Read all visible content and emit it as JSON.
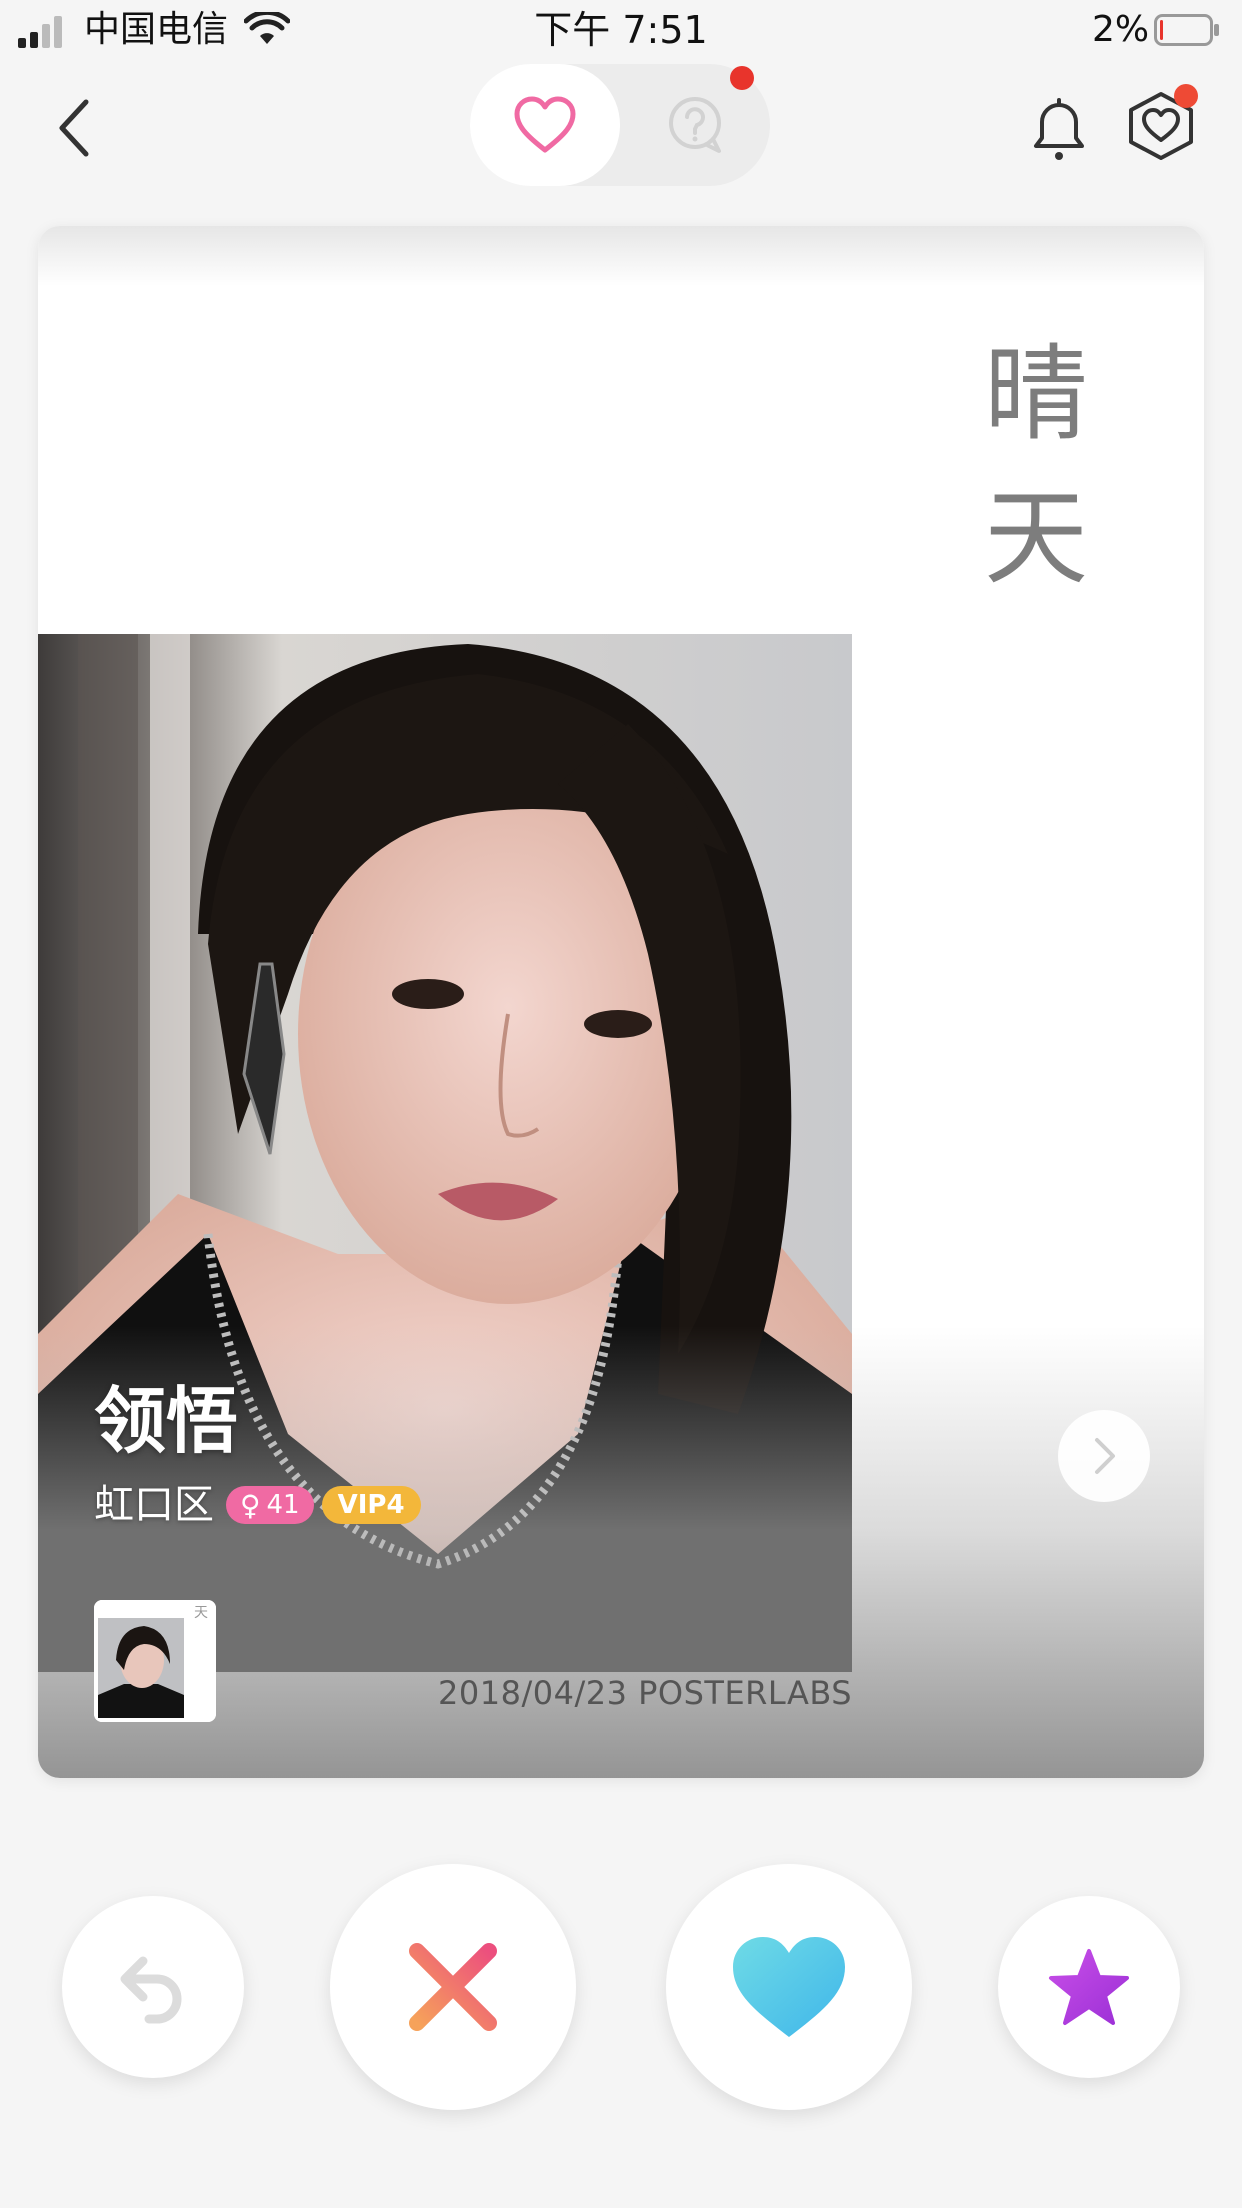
{
  "status_bar": {
    "carrier": "中国电信",
    "time": "下午 7:51",
    "battery_percent": "2%",
    "battery_level": 0.02
  },
  "nav": {
    "back_icon": "chevron-left-icon",
    "segments": [
      {
        "icon": "heart-outline-icon",
        "selected": true
      },
      {
        "icon": "question-bubble-icon",
        "selected": false,
        "has_notification": true
      }
    ],
    "bell_icon": "bell-icon",
    "vip_icon": "hexagon-heart-icon",
    "vip_has_notification": true
  },
  "card": {
    "poster_title": [
      "晴",
      "天"
    ],
    "name": "领悟",
    "district": "虹口区",
    "gender_symbol": "♀",
    "age": "41",
    "vip_level": "VIP4",
    "watermark": "2018/04/23  POSTERLABS",
    "thumbnail_corner": "天",
    "next_icon": "chevron-right-icon"
  },
  "actions": [
    {
      "name": "undo",
      "icon": "undo-icon"
    },
    {
      "name": "dislike",
      "icon": "x-icon"
    },
    {
      "name": "like",
      "icon": "heart-filled-icon"
    },
    {
      "name": "super-like",
      "icon": "star-icon"
    }
  ],
  "colors": {
    "accent_pink": "#f06aa3",
    "vip_gold": "#f3b73a",
    "notification_red": "#e8342c",
    "like_blue": "#49c5e8",
    "nope_gradient": [
      "#f59a5a",
      "#ec5a7a"
    ],
    "star_purple": "#b83fe0"
  }
}
